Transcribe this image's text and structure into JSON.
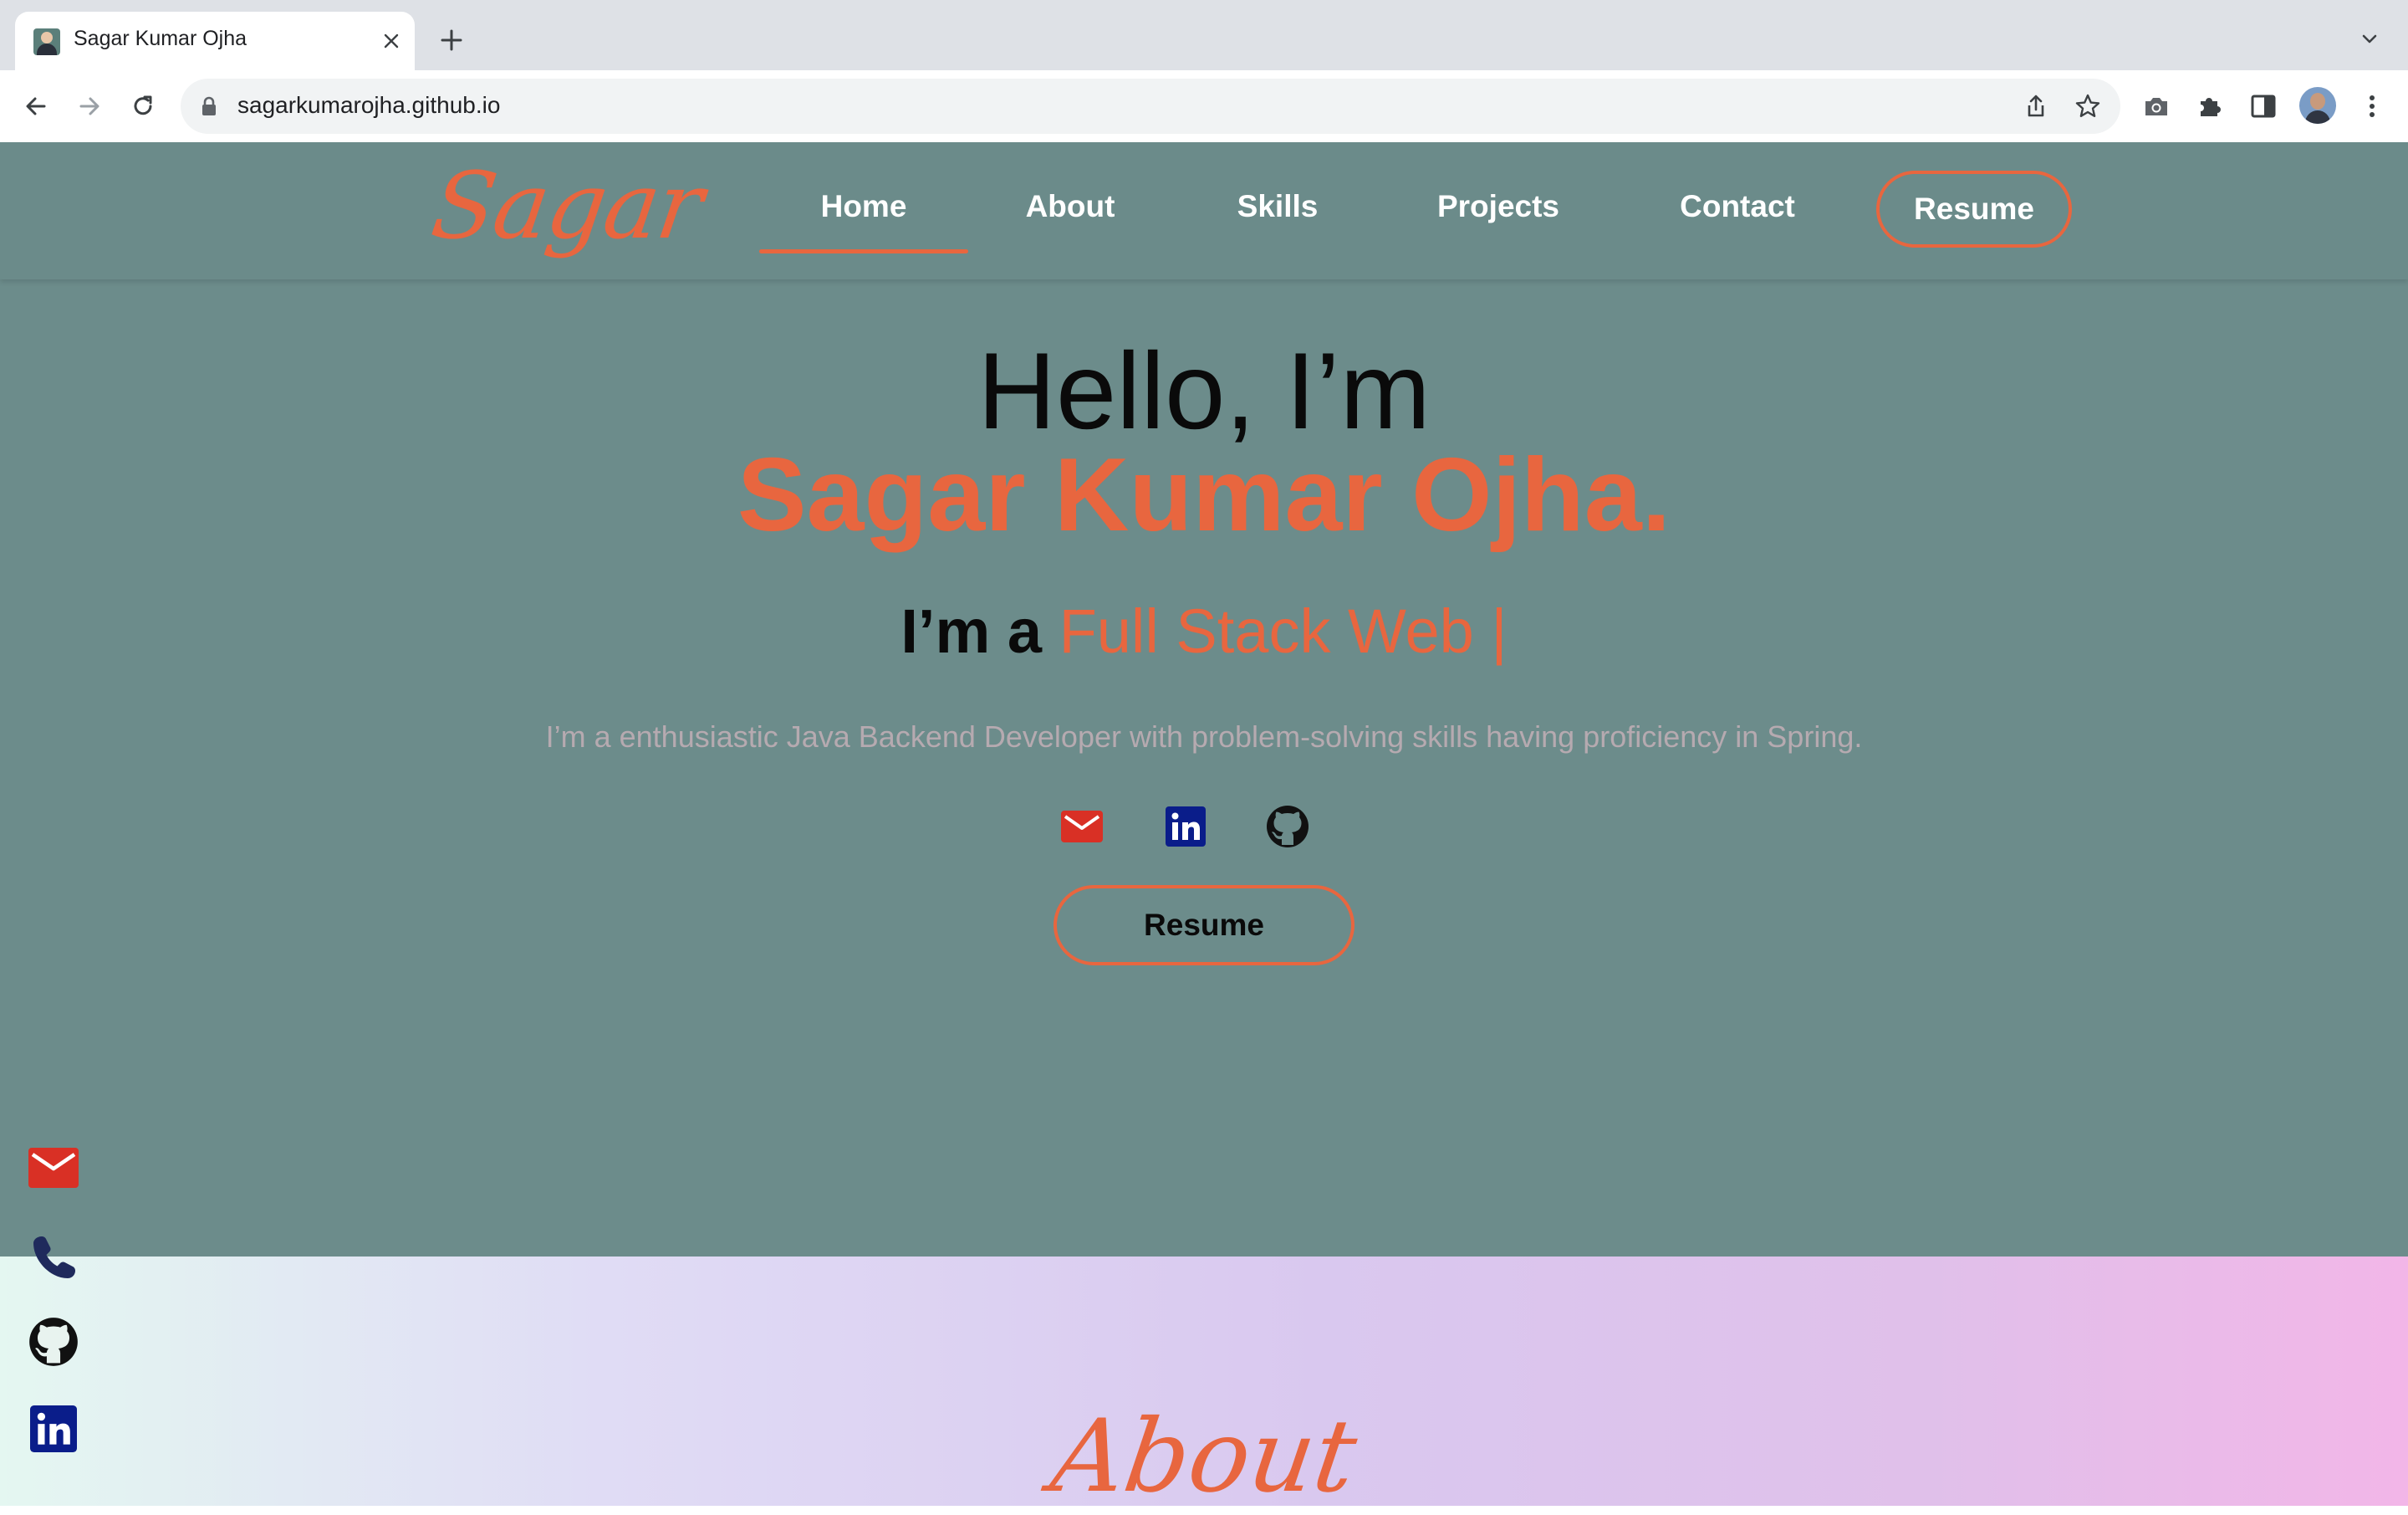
{
  "browser": {
    "tab_title": "Sagar Kumar Ojha",
    "url": "sagarkumarojha.github.io"
  },
  "site": {
    "logo": "Sagar",
    "nav": {
      "home": "Home",
      "about": "About",
      "skills": "Skills",
      "projects": "Projects",
      "contact": "Contact",
      "resume": "Resume"
    },
    "hero": {
      "greeting": "Hello, I’m",
      "name": "Sagar Kumar Ojha.",
      "role_prefix": "I’m a",
      "role_typed": "Full Stack Web |",
      "description": "I’m a enthusiastic Java Backend Developer with problem-solving skills having proficiency in Spring.",
      "resume_button": "Resume"
    },
    "about_heading": "About"
  },
  "colors": {
    "accent": "#e8663f",
    "hero_bg": "#6c8c8b",
    "gmail_red": "#d93025",
    "linkedin_blue": "#0a1d8a"
  },
  "icons": {
    "hero_social": [
      "mail-icon",
      "linkedin-icon",
      "github-icon"
    ],
    "side_social": [
      "mail-icon",
      "phone-icon",
      "github-icon",
      "linkedin-icon"
    ]
  }
}
